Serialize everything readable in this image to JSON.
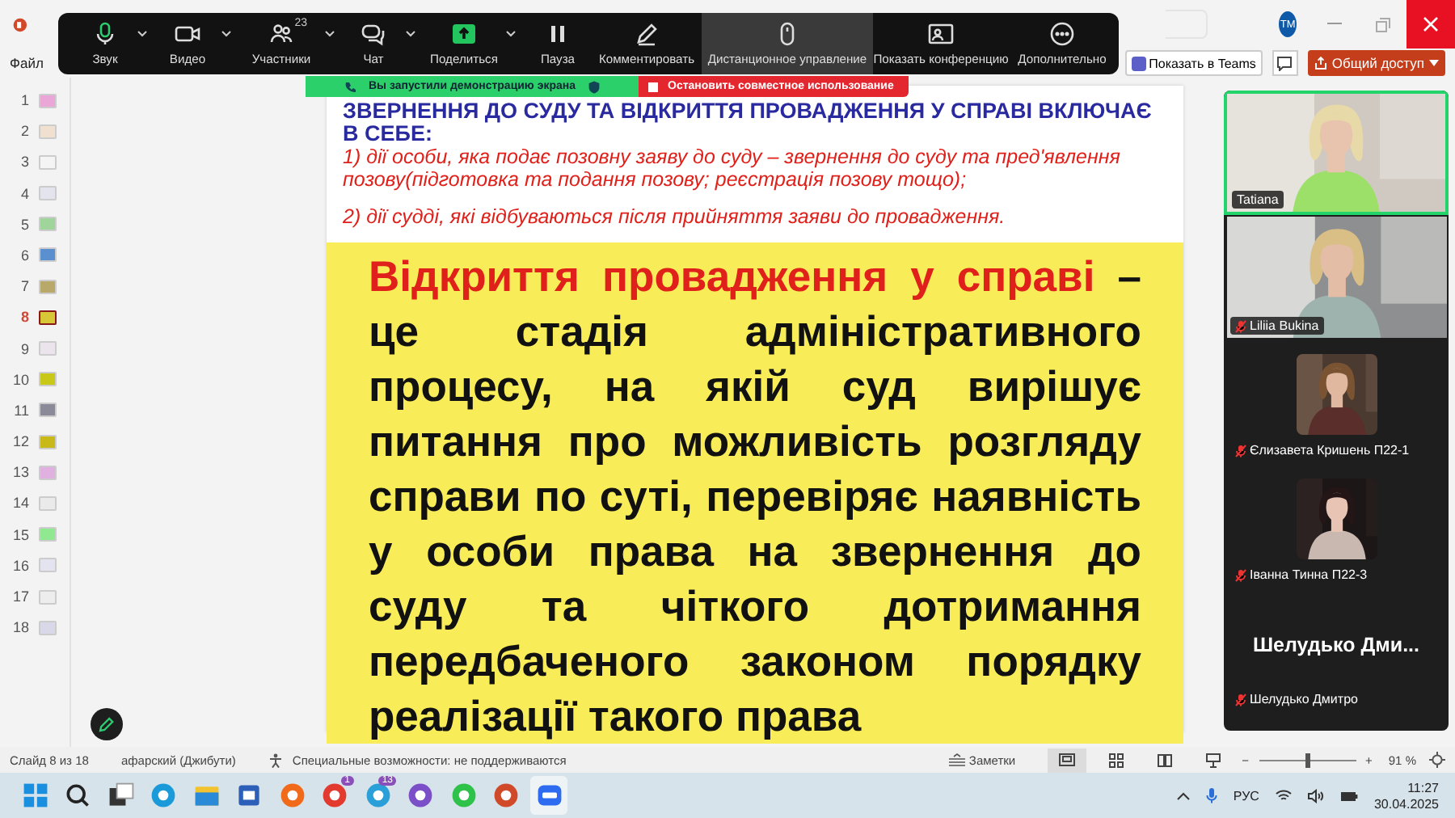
{
  "app_bar": {
    "avatar": "TM"
  },
  "ribbon": {
    "file_tab": "Файл",
    "teams_button": "Показать в Teams",
    "share_button": "Общий доступ"
  },
  "zoom_toolbar": [
    {
      "label": "Звук",
      "has_menu": true,
      "active": false
    },
    {
      "label": "Видео",
      "has_menu": true,
      "active": false
    },
    {
      "label": "Участники",
      "count": "23",
      "has_menu": true,
      "active": false
    },
    {
      "label": "Чат",
      "has_menu": true,
      "active": false
    },
    {
      "label": "Поделиться",
      "has_menu": true,
      "active": false
    },
    {
      "label": "Пауза",
      "has_menu": false,
      "active": false
    },
    {
      "label": "Комментировать",
      "has_menu": false,
      "active": false
    },
    {
      "label": "Дистанционное управление",
      "has_menu": false,
      "active": true
    },
    {
      "label": "Показать конференцию",
      "has_menu": false,
      "active": false
    },
    {
      "label": "Дополнительно",
      "has_menu": false,
      "active": false
    }
  ],
  "share_banner": {
    "message": "Вы запустили демонстрацию экрана",
    "stop": "Остановить совместное использование"
  },
  "slides": [
    {
      "number": "1",
      "selected": false,
      "color": "#e9a6d6"
    },
    {
      "number": "2",
      "selected": false,
      "color": "#f0e0d0"
    },
    {
      "number": "3",
      "selected": false,
      "color": "#f4f4f4"
    },
    {
      "number": "4",
      "selected": false,
      "color": "#e4e4ee"
    },
    {
      "number": "5",
      "selected": false,
      "color": "#9fd49a"
    },
    {
      "number": "6",
      "selected": false,
      "color": "#5a8fd0"
    },
    {
      "number": "7",
      "selected": false,
      "color": "#b8a86a"
    },
    {
      "number": "8",
      "selected": true,
      "color": "#d8c838"
    },
    {
      "number": "9",
      "selected": false,
      "color": "#ece4ec"
    },
    {
      "number": "10",
      "selected": false,
      "color": "#c8c818"
    },
    {
      "number": "11",
      "selected": false,
      "color": "#8a8a98"
    },
    {
      "number": "12",
      "selected": false,
      "color": "#c8b818"
    },
    {
      "number": "13",
      "selected": false,
      "color": "#e0b0e0"
    },
    {
      "number": "14",
      "selected": false,
      "color": "#eaeaea"
    },
    {
      "number": "15",
      "selected": false,
      "color": "#90e890"
    },
    {
      "number": "16",
      "selected": false,
      "color": "#e4e4f0"
    },
    {
      "number": "17",
      "selected": false,
      "color": "#ededed"
    },
    {
      "number": "18",
      "selected": false,
      "color": "#d8d8e8"
    }
  ],
  "slide": {
    "heading": "ЗВЕРНЕННЯ ДО СУДУ ТА ВІДКРИТТЯ ПРОВАДЖЕННЯ У СПРАВІ ВКЛЮЧАЄ В СЕБЕ:",
    "points": [
      "1) дії особи, яка подає позовну заяву до суду – звернення до суду та пред'явлення позову(підготовка та подання позову; реєстрація позову тощо);",
      "2) дії судді, які відбуваються після прийняття заяви до провадження."
    ],
    "term": "Відкриття провадження у справі",
    "definition": " – це стадія адміністративного процесу, на якій суд вирішує питання про можливість розгляду справи по суті, перевіряє наявність у особи права на звернення до суду та чіткого дотримання передбаченого законом порядку реалізації такого права"
  },
  "participants": [
    {
      "kind": "video",
      "name": "Tatiana",
      "muted": false,
      "speaking": true
    },
    {
      "kind": "video",
      "name": "Liliia Bukina",
      "muted": true,
      "speaking": false
    },
    {
      "name": "Єлизавета Кришень П22-1",
      "muted": true,
      "speaking": false
    },
    {
      "name": "Іванна Тинна  П22-3",
      "muted": true,
      "speaking": false
    },
    {
      "kind": "name",
      "display_name": "Шелудько  Дми...",
      "name": "Шелудько Дмитро",
      "muted": true,
      "speaking": false
    }
  ],
  "status_bar": {
    "slide": "Слайд 8 из 18",
    "language": "афарский (Джибути)",
    "accessibility": "Специальные возможности: не поддерживаются",
    "notes": "Заметки",
    "zoom_out": "−",
    "zoom_in": "+",
    "zoom": "91 %",
    "level": 0.5
  },
  "taskbar": {
    "apps": [
      {
        "active": false
      },
      {
        "active": false
      },
      {
        "active": false
      },
      {
        "active": false
      },
      {
        "active": false
      },
      {
        "active": false
      },
      {
        "active": false
      },
      {
        "badge": "1",
        "active": false
      },
      {
        "badge": "13",
        "active": false
      },
      {
        "active": false
      },
      {
        "active": false
      },
      {
        "active": false
      },
      {
        "active": true
      }
    ],
    "language": "РУС",
    "time": "11:27",
    "date": "30.04.2025"
  }
}
